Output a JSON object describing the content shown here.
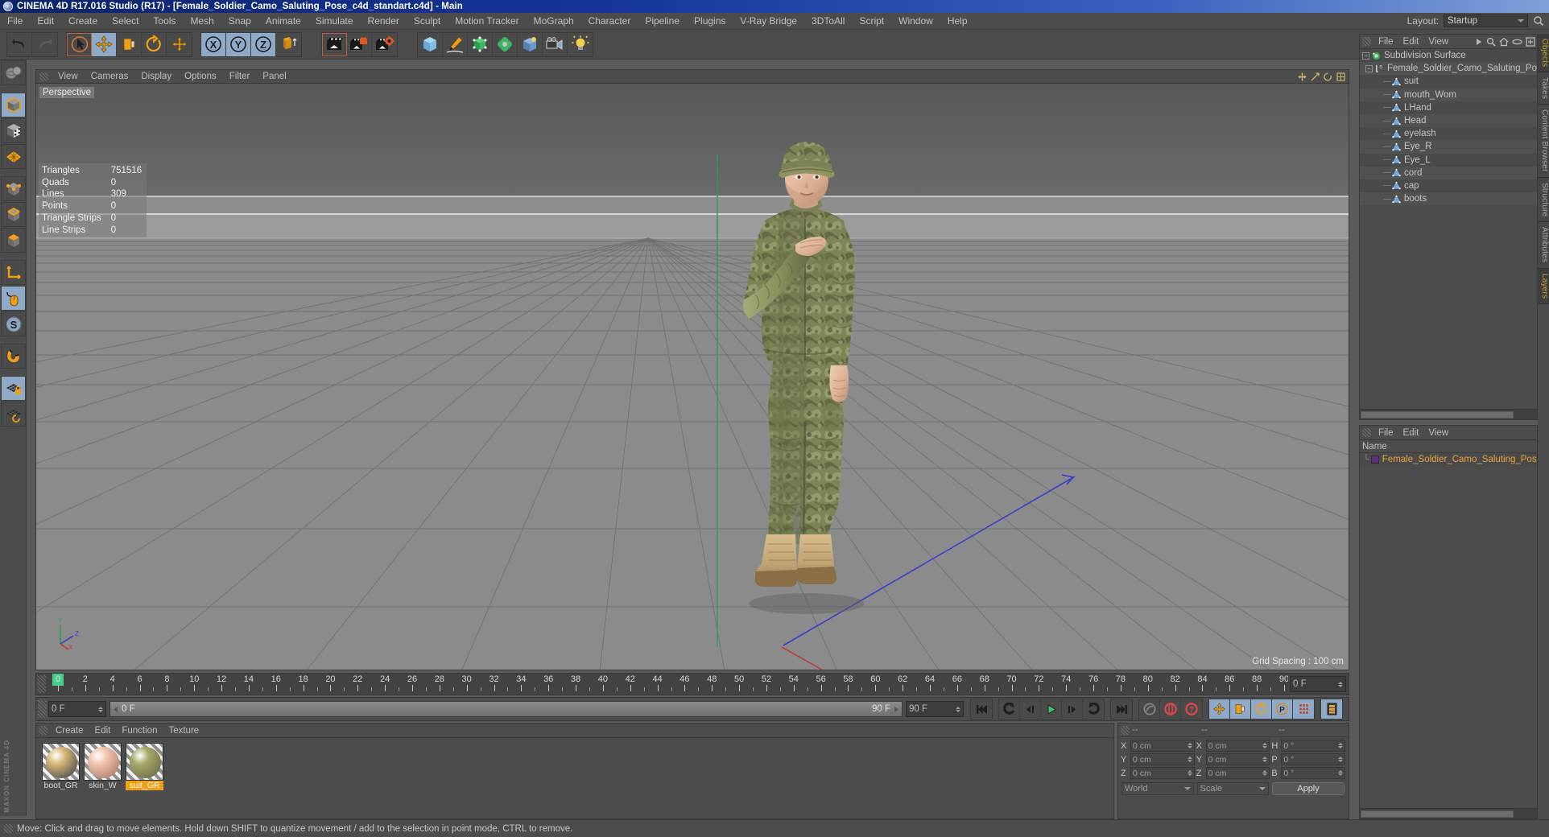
{
  "window": {
    "title": "CINEMA 4D R17.016 Studio (R17) - [Female_Soldier_Camo_Saluting_Pose_c4d_standart.c4d] - Main",
    "app_icon": "cinema4d-logo-icon"
  },
  "menubar": {
    "items": [
      "File",
      "Edit",
      "Create",
      "Select",
      "Tools",
      "Mesh",
      "Snap",
      "Animate",
      "Simulate",
      "Render",
      "Sculpt",
      "Motion Tracker",
      "MoGraph",
      "Character",
      "Pipeline",
      "Plugins",
      "V-Ray Bridge",
      "3DToAll",
      "Script",
      "Window",
      "Help"
    ],
    "layout_label": "Layout:",
    "layout_value": "Startup",
    "search_icon": "search-icon"
  },
  "toolbar": {
    "groups": [
      {
        "name": "undo-redo",
        "buttons": [
          {
            "icon": "undo-icon",
            "label": "Undo",
            "active": false
          },
          {
            "icon": "redo-icon",
            "label": "Redo",
            "active": false,
            "disabled": true
          }
        ]
      },
      {
        "name": "transform-tools",
        "buttons": [
          {
            "icon": "live-selection-icon",
            "label": "Live Selection",
            "active": false,
            "highlight": true
          },
          {
            "icon": "move-icon",
            "label": "Move",
            "active": true
          },
          {
            "icon": "scale-icon",
            "label": "Scale",
            "active": false
          },
          {
            "icon": "rotate-icon",
            "label": "Rotate",
            "active": false
          },
          {
            "icon": "move-alt-icon",
            "label": "Move",
            "active": false
          }
        ]
      },
      {
        "name": "axis-locks",
        "buttons": [
          {
            "icon": "x-axis-icon",
            "label": "X",
            "active": true
          },
          {
            "icon": "y-axis-icon",
            "label": "Y",
            "active": true
          },
          {
            "icon": "z-axis-icon",
            "label": "Z",
            "active": true
          },
          {
            "icon": "world-object-axis-icon",
            "label": "World/Object",
            "active": false
          }
        ]
      },
      {
        "name": "render-tools",
        "buttons": [
          {
            "icon": "render-view-icon",
            "label": "Render View",
            "active": false,
            "highlight": true
          },
          {
            "icon": "render-to-picture-viewer-icon",
            "label": "Render to Picture Viewer",
            "active": false
          },
          {
            "icon": "render-settings-icon",
            "label": "Edit Render Settings",
            "active": false
          }
        ]
      },
      {
        "name": "create-objects",
        "buttons": [
          {
            "icon": "cube-primitive-icon",
            "label": "Add Cube Object",
            "active": false
          },
          {
            "icon": "spline-pen-icon",
            "label": "Add Spline",
            "active": false
          },
          {
            "icon": "generator-icon",
            "label": "Add Generator",
            "active": false
          },
          {
            "icon": "deformer-icon",
            "label": "Add Deformer",
            "active": false
          },
          {
            "icon": "scene-object-icon",
            "label": "Add Scene Object",
            "active": false
          },
          {
            "icon": "camera-icon",
            "label": "Add Camera",
            "active": false
          },
          {
            "icon": "light-icon",
            "label": "Add Light",
            "active": false
          }
        ]
      }
    ]
  },
  "leftbar": {
    "buttons": [
      {
        "icon": "texture-axis-icon",
        "label": "Texture Axis Mode",
        "active": false
      },
      {
        "icon": "model-mode-icon",
        "label": "Model Mode",
        "active": true
      },
      {
        "icon": "texture-mode-icon",
        "label": "Texture Mode",
        "active": false
      },
      {
        "icon": "polygon-mode-icon",
        "label": "Polygon Mode",
        "active": false
      },
      {
        "icon": "points-mode-icon",
        "label": "Points Mode",
        "active": false
      },
      {
        "icon": "edges-mode-icon",
        "label": "Edges Mode",
        "active": false
      },
      {
        "icon": "object-axis-icon",
        "label": "Enable Axis Modification",
        "active": false
      },
      {
        "icon": "world-coordinates-icon",
        "label": "World/Object Coordinate System",
        "active": false
      },
      {
        "icon": "viewport-solo-icon",
        "label": "Viewport Solo",
        "active": true
      },
      {
        "icon": "snap-s-icon",
        "label": "Enable Snapping",
        "active": false
      },
      {
        "icon": "magnet-icon",
        "label": "Magnet",
        "active": false
      },
      {
        "icon": "workplane-lock-icon",
        "label": "Lock Workplane",
        "active": true
      },
      {
        "icon": "workplane-rotate-icon",
        "label": "Planar Workplane",
        "active": false
      }
    ],
    "brand": "MAXON CINEMA 4D"
  },
  "viewport": {
    "menu": [
      "View",
      "Cameras",
      "Display",
      "Options",
      "Filter",
      "Panel"
    ],
    "camera_tag": "Perspective",
    "grid_spacing": "Grid Spacing : 100 cm",
    "corner_icons": [
      "move-view-icon",
      "scale-view-icon",
      "rotate-view-icon",
      "maximize-view-icon"
    ],
    "stats": [
      {
        "label": "Triangles",
        "value": "751516"
      },
      {
        "label": "Quads",
        "value": "0"
      },
      {
        "label": "Lines",
        "value": "309"
      },
      {
        "label": "Points",
        "value": "0"
      },
      {
        "label": "Triangle Strips",
        "value": "0"
      },
      {
        "label": "Line Strips",
        "value": "0"
      }
    ],
    "axis_labels": [
      "Y",
      "Z",
      "X"
    ]
  },
  "object_manager": {
    "menu": [
      "File",
      "Edit",
      "View"
    ],
    "right_icons": [
      "play-arrow-icon",
      "search-icon",
      "home-icon",
      "eye-icon",
      "new-tab-icon"
    ],
    "nodes": [
      {
        "label": "Subdivision Surface",
        "icon": "subdivision-surface-icon",
        "depth": 0,
        "expandable": true
      },
      {
        "label": "Female_Soldier_Camo_Saluting_Po",
        "icon": "null-object-icon",
        "depth": 1,
        "expandable": true
      },
      {
        "label": "suit",
        "icon": "polygon-object-icon",
        "depth": 2,
        "expandable": false
      },
      {
        "label": "mouth_Wom",
        "icon": "polygon-object-icon",
        "depth": 2,
        "expandable": false
      },
      {
        "label": "LHand",
        "icon": "polygon-object-icon",
        "depth": 2,
        "expandable": false
      },
      {
        "label": "Head",
        "icon": "polygon-object-icon",
        "depth": 2,
        "expandable": false
      },
      {
        "label": "eyelash",
        "icon": "polygon-object-icon",
        "depth": 2,
        "expandable": false
      },
      {
        "label": "Eye_R",
        "icon": "polygon-object-icon",
        "depth": 2,
        "expandable": false
      },
      {
        "label": "Eye_L",
        "icon": "polygon-object-icon",
        "depth": 2,
        "expandable": false
      },
      {
        "label": "cord",
        "icon": "polygon-object-icon",
        "depth": 2,
        "expandable": false
      },
      {
        "label": "cap",
        "icon": "polygon-object-icon",
        "depth": 2,
        "expandable": false
      },
      {
        "label": "boots",
        "icon": "polygon-object-icon",
        "depth": 2,
        "expandable": false
      }
    ]
  },
  "layer_manager": {
    "menu": [
      "File",
      "Edit",
      "View"
    ],
    "column_header": "Name",
    "rows": [
      {
        "label": "Female_Soldier_Camo_Saluting_Pos",
        "color": "#5b2f7e"
      }
    ]
  },
  "dock_tabs": [
    {
      "label": "Objects",
      "accent": true
    },
    {
      "label": "Takes",
      "accent": false
    },
    {
      "label": "Content Browser",
      "accent": false
    },
    {
      "label": "Structure",
      "accent": false
    },
    {
      "label": "Attributes",
      "accent": false
    },
    {
      "label": "Layers",
      "accent": true
    }
  ],
  "timeline": {
    "min_frame": 0,
    "max_frame": 90,
    "current_frame": 0,
    "tick_labels": [
      0,
      2,
      4,
      6,
      8,
      10,
      12,
      14,
      16,
      18,
      20,
      22,
      24,
      26,
      28,
      30,
      32,
      34,
      36,
      38,
      40,
      42,
      44,
      46,
      48,
      50,
      52,
      54,
      56,
      58,
      60,
      62,
      64,
      66,
      68,
      70,
      72,
      74,
      76,
      78,
      80,
      82,
      84,
      86,
      88,
      90
    ],
    "end_field": "0 F"
  },
  "playback": {
    "current_frame_field": "0 F",
    "range_start": "0 F",
    "range_end": "90 F",
    "max_frame_field": "90 F",
    "transport": [
      {
        "icon": "go-to-start-icon",
        "label": "Go to Start",
        "active": false
      },
      {
        "icon": "previous-key-icon",
        "label": "Go to Previous Key",
        "active": false
      },
      {
        "icon": "step-back-icon",
        "label": "Go to Previous Frame",
        "active": false
      },
      {
        "icon": "play-icon",
        "label": "Play Forwards",
        "active": false
      },
      {
        "icon": "step-forward-icon",
        "label": "Go to Next Frame",
        "active": false
      },
      {
        "icon": "next-key-icon",
        "label": "Go to Next Key",
        "active": false
      },
      {
        "icon": "go-to-end-icon",
        "label": "Go to End",
        "active": false
      }
    ],
    "record_group": [
      {
        "icon": "autokeying-icon",
        "label": "Autokeying",
        "active": false
      },
      {
        "icon": "record-active-objects-icon",
        "label": "Record Active Objects",
        "active": false
      },
      {
        "icon": "keyframe-selection-icon",
        "label": "Keyframe Selection",
        "active": false
      }
    ],
    "key_group": [
      {
        "icon": "position-key-icon",
        "label": "Position",
        "active": true
      },
      {
        "icon": "scale-key-icon",
        "label": "Scale",
        "active": true
      },
      {
        "icon": "rotation-key-icon",
        "label": "Rotation",
        "active": true
      },
      {
        "icon": "param-key-icon",
        "label": "Parameter",
        "active": true
      },
      {
        "icon": "point-level-animation-icon",
        "label": "Point Level Animation",
        "active": true
      }
    ],
    "extra_group": [
      {
        "icon": "timeline-toggle-icon",
        "label": "Animation Mode",
        "active": true
      }
    ]
  },
  "material_manager": {
    "menu": [
      "Create",
      "Edit",
      "Function",
      "Texture"
    ],
    "materials": [
      {
        "name": "boot_GR",
        "selected": false,
        "color_top": "#d8b878",
        "color_bot": "#4a4a4a"
      },
      {
        "name": "skin_W",
        "selected": false,
        "color_top": "#f2c5b0",
        "color_bot": "#b07a6c"
      },
      {
        "name": "suit_GR",
        "selected": true,
        "color_top": "#a8a86a",
        "color_bot": "#6a6a46"
      }
    ]
  },
  "coordinates": {
    "header_cells": [
      "--",
      "--",
      "--"
    ],
    "rows": [
      {
        "label_pos": "X",
        "pos": "0 cm",
        "label_size": "X",
        "size": "0 cm",
        "label_rot": "H",
        "rot": "0 °"
      },
      {
        "label_pos": "Y",
        "pos": "0 cm",
        "label_size": "Y",
        "size": "0 cm",
        "label_rot": "P",
        "rot": "0 °"
      },
      {
        "label_pos": "Z",
        "pos": "0 cm",
        "label_size": "Z",
        "size": "0 cm",
        "label_rot": "B",
        "rot": "0 °"
      }
    ],
    "system_select": "World",
    "mode_select": "Scale",
    "apply_label": "Apply"
  },
  "statusbar": {
    "message": "Move: Click and drag to move elements. Hold down SHIFT to quantize movement / add to the selection in point mode, CTRL to remove."
  },
  "colors": {
    "accent_orange": "#f0a016",
    "accent_blue": "#8fa9c8",
    "panel_bg": "#4c4c4c",
    "title_blue": "#15359c",
    "layer_text": "#e8a33d",
    "timeline_marker": "#43d18a"
  }
}
